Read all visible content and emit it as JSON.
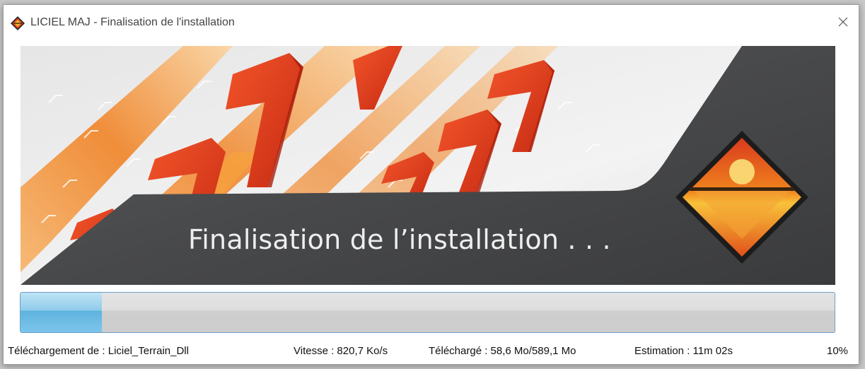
{
  "window": {
    "title": "LICIEL MAJ - Finalisation de l'installation",
    "close_symbol": "✕"
  },
  "banner": {
    "title": "Finalisation de l’installation . . .",
    "logo": "liciel-diamond-logo"
  },
  "progress": {
    "fraction": 0.1
  },
  "status": {
    "downloading": "Téléchargement de : Liciel_Terrain_Dll",
    "speed": "Vitesse : 820,7 Ko/s",
    "downloaded": "Téléchargé : 58,6 Mo/589,1 Mo",
    "estimate": "Estimation : 11m 02s",
    "percent": "10%"
  },
  "colors": {
    "orange": "#f07a1a",
    "red": "#d9351c",
    "banner_dark": "#4a4b4d",
    "progress_fill": "#6fbde6",
    "progress_border": "#6d9ec6"
  },
  "icons": {
    "app": "liciel-diamond-icon",
    "close": "close-icon"
  }
}
